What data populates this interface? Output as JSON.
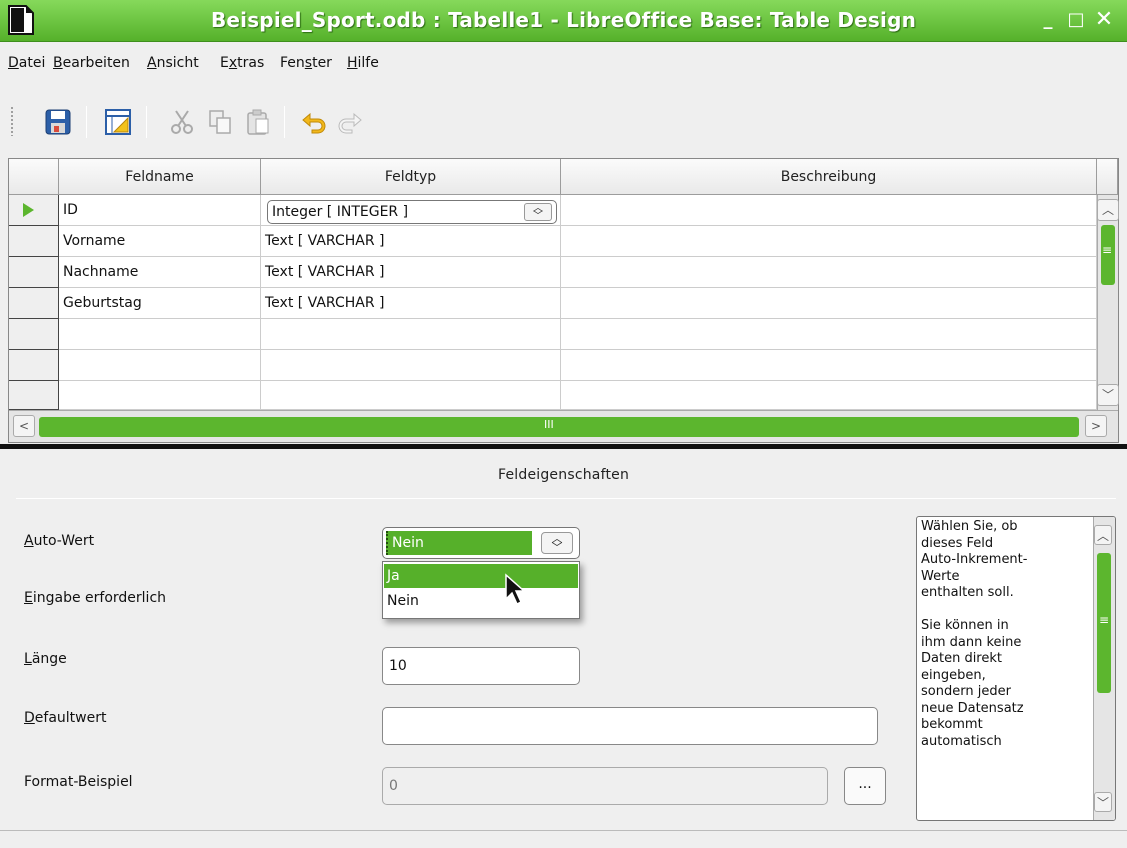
{
  "window": {
    "title": "Beispiel_Sport.odb : Tabelle1 - LibreOffice Base: Table Design",
    "min_label": "_",
    "max_label": "□",
    "close_label": "✕"
  },
  "menu": {
    "items": [
      {
        "u": "D",
        "rest": "atei"
      },
      {
        "u": "B",
        "rest": "earbeiten"
      },
      {
        "u": "A",
        "rest": "nsicht"
      },
      {
        "pre": "E",
        "u": "x",
        "rest": "tras"
      },
      {
        "pre": "Fen",
        "u": "s",
        "rest": "ter"
      },
      {
        "u": "H",
        "rest": "ilfe"
      }
    ]
  },
  "toolbar": {
    "icons": [
      "save-icon",
      "index-design-icon",
      "cut-icon",
      "copy-icon",
      "paste-icon",
      "undo-icon",
      "redo-icon"
    ]
  },
  "grid": {
    "headers": [
      "Feldname",
      "Feldtyp",
      "Beschreibung"
    ],
    "rows": [
      {
        "name": "ID",
        "type": "Integer [ INTEGER ]",
        "desc": ""
      },
      {
        "name": "Vorname",
        "type": "Text [ VARCHAR ]",
        "desc": ""
      },
      {
        "name": "Nachname",
        "type": "Text [ VARCHAR ]",
        "desc": ""
      },
      {
        "name": "Geburtstag",
        "type": "Text [ VARCHAR ]",
        "desc": ""
      }
    ],
    "hscroll_label": "III",
    "vscroll_label": "≡"
  },
  "properties": {
    "title": "Feldeigenschaften",
    "auto_wert": {
      "u": "A",
      "rest": "uto-Wert",
      "value": "Nein",
      "options": [
        "Ja",
        "Nein"
      ]
    },
    "eingabe": {
      "u": "E",
      "rest": "ingabe erforderlich"
    },
    "laenge": {
      "u": "L",
      "rest": "änge",
      "value": "10"
    },
    "defaultwert": {
      "u": "D",
      "rest": "efaultwert",
      "value": ""
    },
    "format": {
      "label": "Format-Beispiel",
      "value": "0",
      "button": "..."
    },
    "help_text": "Wählen Sie, ob\ndieses Feld\nAuto-Inkrement-\nWerte\nenthalten soll.\n\nSie können in\nihm dann keine\nDaten direkt\neingeben,\nsondern jeder\nneue Datensatz\nbekommt\nautomatisch"
  },
  "colors": {
    "accent": "#56b02a",
    "titlebar_top": "#86d95b",
    "titlebar_bottom": "#55b12a"
  }
}
